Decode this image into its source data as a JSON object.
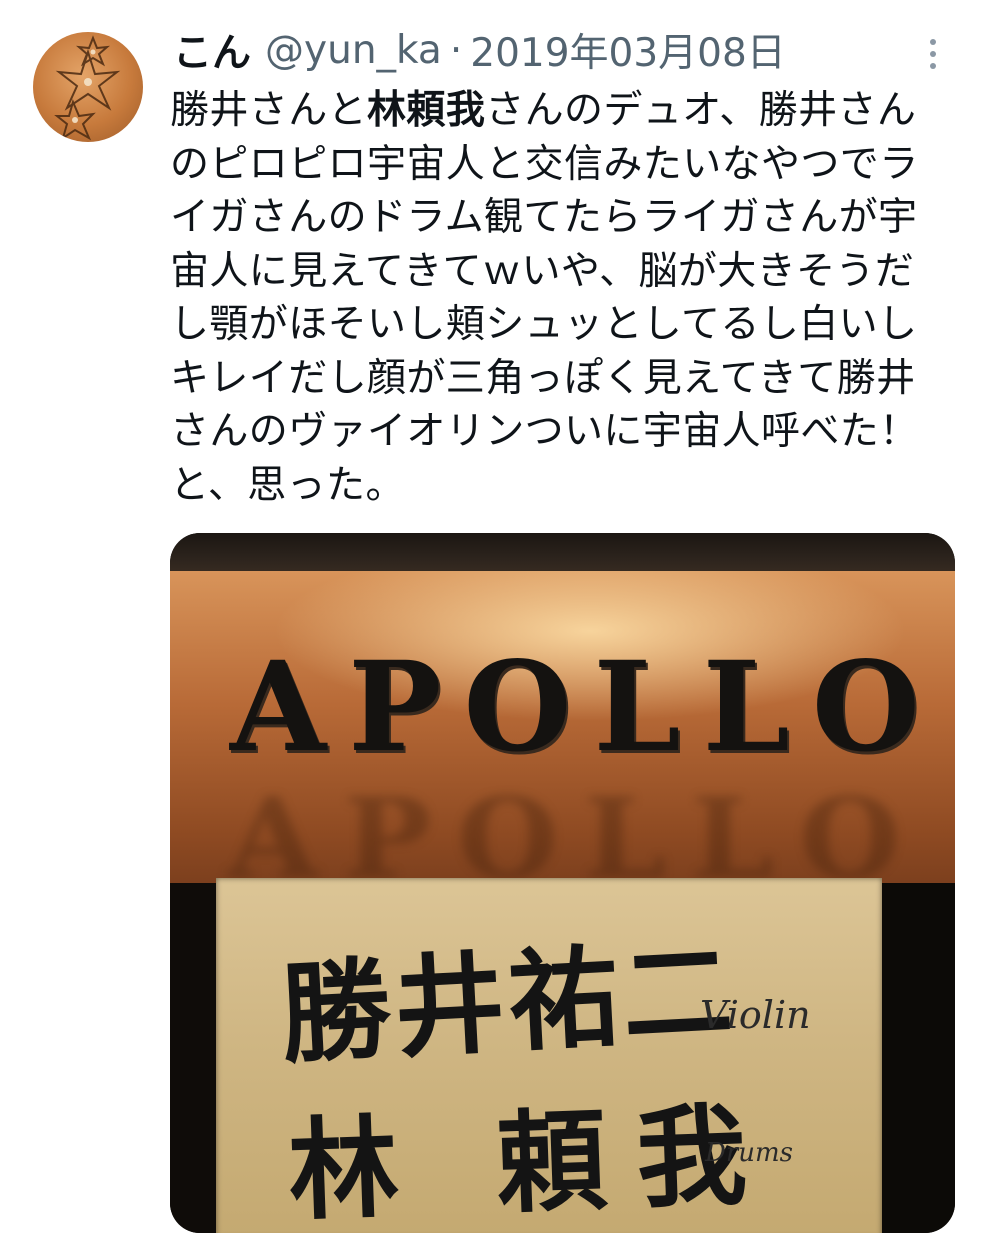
{
  "tweet": {
    "author": {
      "display_name": "こん",
      "handle": "@yun_ka",
      "avatar_icon": "lily-flower-avatar"
    },
    "separator": "·",
    "date": "2019年03月08日",
    "more_icon": "more-vertical-icon",
    "text_lines": [
      "のピロピロ宇宙人と交信みたいなやつでラ",
      "イガさんのドラム観てたらライガさんが宇",
      "宙人に見えてきてｗいや、脳が大きそうだ",
      "し顎がほそいし頬シュッとしてるし白いし",
      "キレイだし顔が三角っぽく見えてきて勝井",
      "さんのヴァイオリンついに宇宙人呼べた！",
      "と、思った。"
    ],
    "first_line": {
      "before": "勝井さんと",
      "bold": "林頼我",
      "after": "さんのデュオ、勝井さん"
    },
    "photo": {
      "sign_text": "APOLLO",
      "paper_names": [
        "勝井祐二",
        "林 頼我"
      ],
      "paper_roles": [
        "Violin",
        "Drums"
      ]
    }
  }
}
